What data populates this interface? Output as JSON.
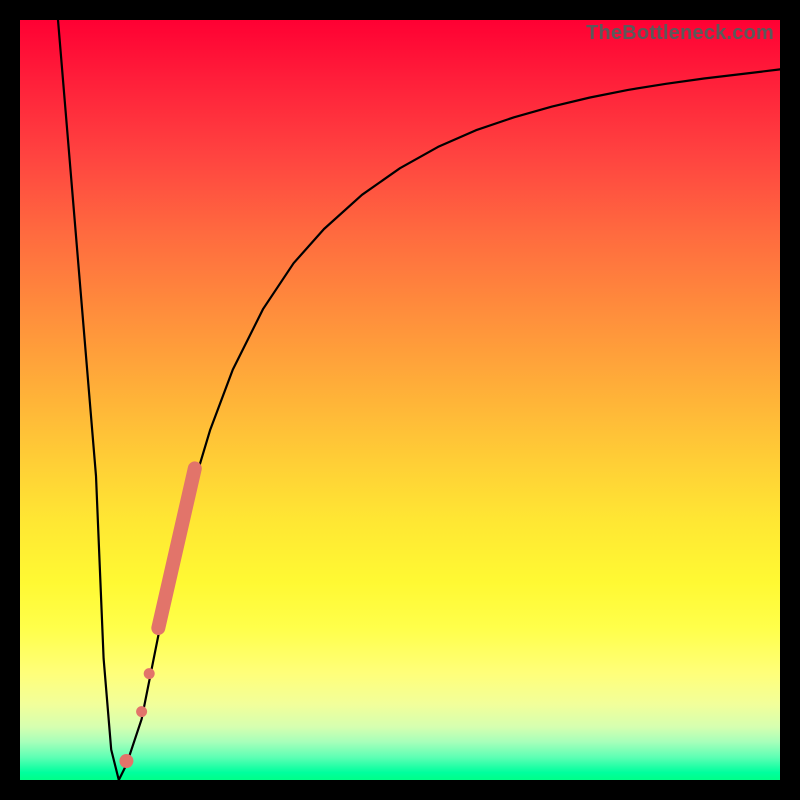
{
  "watermark": "TheBottleneck.com",
  "chart_data": {
    "type": "line",
    "title": "",
    "xlabel": "",
    "ylabel": "",
    "xlim": [
      0,
      100
    ],
    "ylim": [
      0,
      100
    ],
    "grid": false,
    "series": [
      {
        "name": "bottleneck-curve",
        "x": [
          5,
          6,
          7,
          8,
          9,
          10,
          10.5,
          11,
          12,
          13,
          14,
          16,
          18,
          20,
          22,
          25,
          28,
          32,
          36,
          40,
          45,
          50,
          55,
          60,
          65,
          70,
          75,
          80,
          85,
          90,
          95,
          100
        ],
        "y": [
          100,
          88,
          76,
          64,
          52,
          40,
          28,
          16,
          4,
          0,
          2,
          8,
          18,
          28,
          36,
          46,
          54,
          62,
          68,
          72.5,
          77,
          80.5,
          83.3,
          85.5,
          87.2,
          88.6,
          89.8,
          90.8,
          91.6,
          92.3,
          92.9,
          93.5
        ]
      }
    ],
    "markers": {
      "name": "highlighted-range",
      "color": "#e2746a",
      "bar": {
        "x": [
          18.2,
          23.0
        ],
        "y": [
          20,
          41
        ]
      },
      "dots": [
        {
          "x": 17.0,
          "y": 14.0
        },
        {
          "x": 16.0,
          "y": 9.0
        },
        {
          "x": 14.0,
          "y": 2.5
        }
      ]
    },
    "background_gradient": {
      "top": "#ff0033",
      "bottom": "#00ff88"
    }
  }
}
